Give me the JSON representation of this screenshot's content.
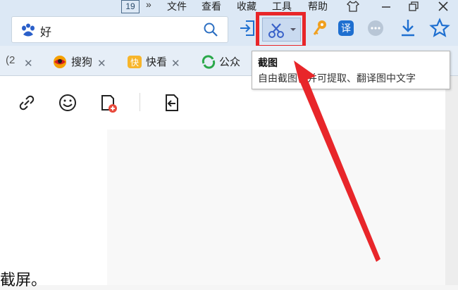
{
  "titlebar": {
    "badge": "19",
    "chevron": "»",
    "menu": [
      "文件",
      "查看",
      "收藏",
      "工具",
      "帮助"
    ]
  },
  "toolbar": {
    "address_text": "好"
  },
  "tabs": [
    {
      "label": "(2"
    },
    {
      "label": "搜狗"
    },
    {
      "label": "快看"
    },
    {
      "label": "公众"
    }
  ],
  "tooltip": {
    "title": "截图",
    "desc_left": "自由截图",
    "desc_right": "并可提取、翻译图中文字"
  },
  "content": {
    "text": "截屏。"
  },
  "colors": {
    "highlight": "#e8262a",
    "accent_blue": "#1e6fd0"
  }
}
